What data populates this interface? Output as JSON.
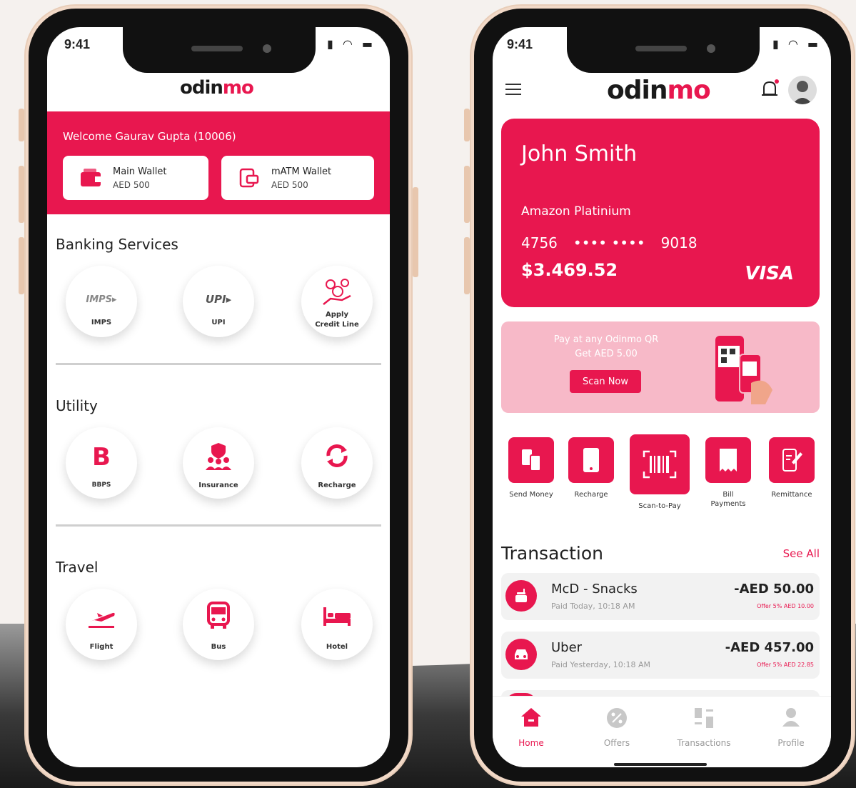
{
  "colors": {
    "brand": "#e8174f",
    "text": "#1a1a1a",
    "promo": "#f7b9c8"
  },
  "left_phone": {
    "status_time": "9:41",
    "brand": {
      "prefix": "odin",
      "suffix": "mo"
    },
    "welcome": "Welcome Gaurav Gupta (10006)",
    "wallets": [
      {
        "icon": "wallet-icon",
        "name": "Main Wallet",
        "balance": "AED 500"
      },
      {
        "icon": "atm-card-icon",
        "name": "mATM Wallet",
        "balance": "AED 500"
      }
    ],
    "sections": [
      {
        "title": "Banking Services",
        "items": [
          {
            "label": "IMPS",
            "logo": "IMPS▸",
            "icon": "imps-logo-icon"
          },
          {
            "label": "UPI",
            "logo": "UPI▸",
            "icon": "upi-logo-icon"
          },
          {
            "label": "Apply\nCredit Line",
            "icon": "credit-line-icon"
          }
        ]
      },
      {
        "title": "Utility",
        "items": [
          {
            "label": "BBPS",
            "logo": "B",
            "icon": "bbps-icon"
          },
          {
            "label": "Insurance",
            "icon": "insurance-icon"
          },
          {
            "label": "Recharge",
            "icon": "recharge-icon"
          }
        ]
      },
      {
        "title": "Travel",
        "items": [
          {
            "label": "Flight",
            "icon": "flight-icon"
          },
          {
            "label": "Bus",
            "icon": "bus-icon"
          },
          {
            "label": "Hotel",
            "icon": "hotel-icon"
          }
        ]
      }
    ]
  },
  "right_phone": {
    "status_time": "9:41",
    "brand": {
      "prefix": "odin",
      "suffix": "mo"
    },
    "card": {
      "holder": "John Smith",
      "product": "Amazon Platinium",
      "number_first": "4756",
      "number_masked": "•••• ••••",
      "number_last": "9018",
      "balance": "$3.469.52",
      "network": "VISA"
    },
    "promo": {
      "line1": "Pay at any Odinmo QR",
      "line2": "Get AED 5.00",
      "button": "Scan Now"
    },
    "quick_actions": [
      {
        "label": "Send Money",
        "icon": "send-money-icon"
      },
      {
        "label": "Recharge",
        "icon": "mobile-recharge-icon"
      },
      {
        "label": "Scan-to-Pay",
        "icon": "barcode-scan-icon"
      },
      {
        "label": "Bill Payments",
        "icon": "bill-icon"
      },
      {
        "label": "Remittance",
        "icon": "remittance-icon"
      }
    ],
    "transactions_title": "Transaction",
    "see_all": "See All",
    "transactions": [
      {
        "name": "McD - Snacks",
        "sub": "Paid Today, 10:18 AM",
        "amount": "-AED 50.00",
        "offer": "Offer 5% AED 10.00",
        "icon": "food-icon"
      },
      {
        "name": "Uber",
        "sub": "Paid Yesterday, 10:18 AM",
        "amount": "-AED 457.00",
        "offer": "Offer 5% AED 22.85",
        "icon": "car-icon"
      }
    ],
    "tabs": [
      {
        "label": "Home",
        "icon": "home-icon",
        "active": true
      },
      {
        "label": "Offers",
        "icon": "offers-icon",
        "active": false
      },
      {
        "label": "Transactions",
        "icon": "transactions-icon",
        "active": false
      },
      {
        "label": "Profile",
        "icon": "profile-icon",
        "active": false
      }
    ]
  }
}
